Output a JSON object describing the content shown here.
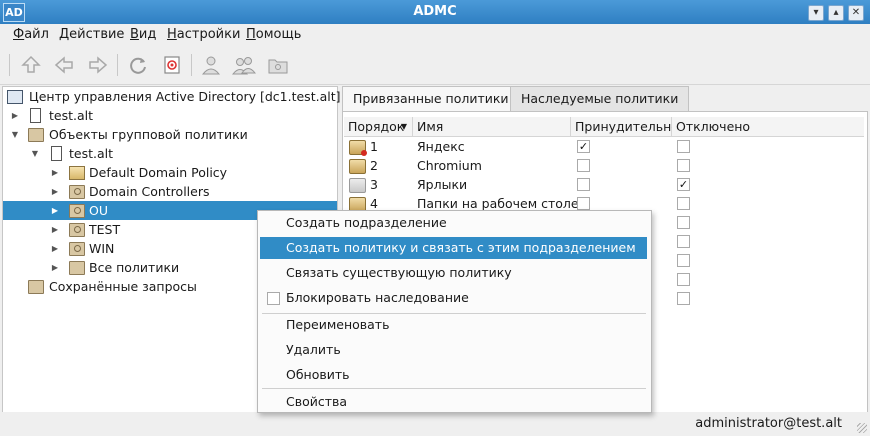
{
  "window": {
    "logo": "AD",
    "title": "ADMC",
    "minimize": "▾",
    "maximize": "▴",
    "close": "✕"
  },
  "menu": [
    {
      "label": "Файл",
      "ul": "Ф",
      "rest": "айл"
    },
    {
      "label": "Действие",
      "ul": "Д",
      "rest": "ействие"
    },
    {
      "label": "Вид",
      "ul": "В",
      "rest": "ид"
    },
    {
      "label": "Настройки",
      "ul": "Н",
      "rest": "астройки"
    },
    {
      "label": "Помощь",
      "ul": "П",
      "rest": "омощь"
    }
  ],
  "toolbar": {
    "icons": [
      "up-icon",
      "back-icon",
      "forward-icon",
      "refresh-icon",
      "properties-icon",
      "user-icon",
      "group-icon",
      "folder-icon"
    ]
  },
  "tree": {
    "root": "Центр управления Active Directory [dc1.test.alt]",
    "domain": "test.alt",
    "gpo_container": "Объекты групповой политики",
    "gpo_domain": "test.alt",
    "items": [
      "Default Domain Policy",
      "Domain Controllers",
      "OU",
      "TEST",
      "WIN",
      "Все политики"
    ],
    "selected": "OU",
    "saved_queries": "Сохранённые запросы"
  },
  "tabs": {
    "linked": "Привязанные политики",
    "inherited": "Наследуемые политики",
    "active": "linked"
  },
  "table": {
    "columns": [
      "Порядок",
      "Имя",
      "Принудительно",
      "Отключено"
    ],
    "sort_indicator": "▼",
    "rows": [
      {
        "order": "1",
        "name": "Яндекс",
        "enforced": true,
        "disabled": false,
        "icon_state": "error"
      },
      {
        "order": "2",
        "name": "Chromium",
        "enforced": false,
        "disabled": false,
        "icon_state": "normal"
      },
      {
        "order": "3",
        "name": "Ярлыки",
        "enforced": false,
        "disabled": true,
        "icon_state": "dim"
      },
      {
        "order": "4",
        "name": "Папки на рабочем столе",
        "enforced": false,
        "disabled": false,
        "icon_state": "normal"
      },
      {
        "order": "",
        "name": "",
        "enforced": false,
        "disabled": false,
        "icon_state": "hidden"
      },
      {
        "order": "",
        "name": "",
        "enforced": false,
        "disabled": false,
        "icon_state": "hidden"
      },
      {
        "order": "",
        "name": "",
        "enforced": false,
        "disabled": false,
        "icon_state": "hidden"
      },
      {
        "order": "",
        "name": "",
        "enforced": false,
        "disabled": false,
        "icon_state": "hidden"
      },
      {
        "order": "",
        "name": "",
        "enforced": false,
        "disabled": false,
        "icon_state": "hidden"
      }
    ]
  },
  "context_menu": {
    "create_ou": "Создать подразделение",
    "create_and_link": "Создать политику и связать с этим подразделением",
    "link_existing": "Связать существующую политику",
    "block_inheritance": "Блокировать наследование",
    "rename": "Переименовать",
    "delete": "Удалить",
    "refresh": "Обновить",
    "properties": "Свойства"
  },
  "status": {
    "user": "administrator@test.alt"
  },
  "colors": {
    "accent": "#308cc6",
    "titlebar": "#3a86c8",
    "error_dot": "#d42a1f"
  }
}
